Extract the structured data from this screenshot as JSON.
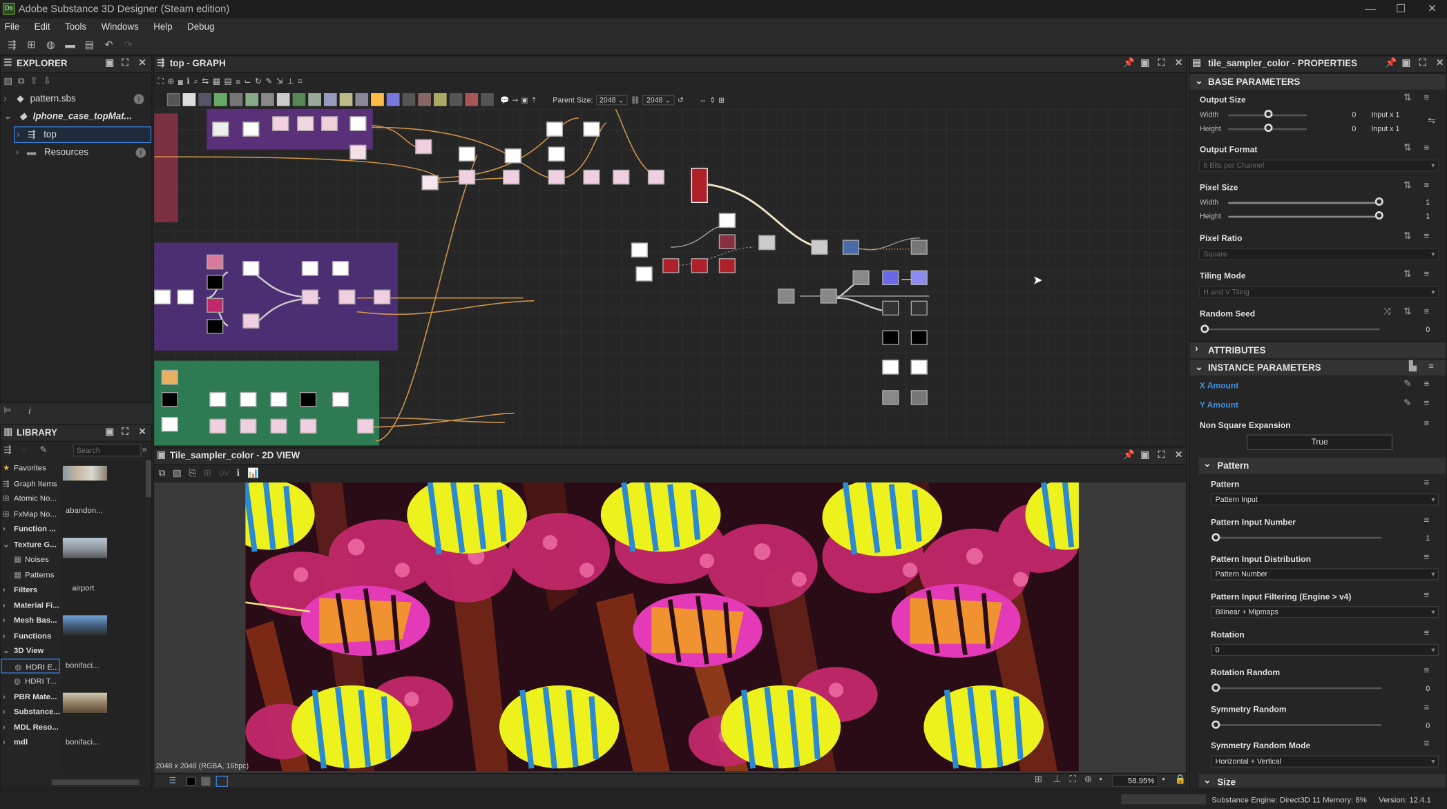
{
  "window": {
    "title": "Adobe Substance 3D Designer (Steam edition)",
    "logo": "Ds"
  },
  "menu": [
    "File",
    "Edit",
    "Tools",
    "Windows",
    "Help",
    "Debug"
  ],
  "explorer": {
    "title": "EXPLORER",
    "items": [
      {
        "label": "pattern.sbs"
      },
      {
        "label": "Iphone_case_topMat..."
      },
      {
        "label": "top"
      },
      {
        "label": "Resources"
      }
    ]
  },
  "library": {
    "title": "LIBRARY",
    "search_placeholder": "Search",
    "categories": [
      "Favorites",
      "Graph Items",
      "Atomic No...",
      "FxMap No...",
      "Function ...",
      "Texture G...",
      "Noises",
      "Patterns",
      "Filters",
      "Material Fi...",
      "Mesh Bas...",
      "Functions",
      "3D View",
      "HDRI E...",
      "HDRI T...",
      "PBR Mate...",
      "Substance...",
      "MDL Reso...",
      "mdl"
    ],
    "thumbs": [
      "abandon...",
      "airport",
      "bonifaci...",
      "bonifaci..."
    ]
  },
  "graph": {
    "title": "top - GRAPH",
    "parent_size_label": "Parent Size:",
    "parent_size": "2048",
    "size2": "2048"
  },
  "view2d": {
    "title": "Tile_sampler_color - 2D VIEW",
    "uv": "UV",
    "info": "2048 x 2048 (RGBA, 16bpc)",
    "zoom": "58.95%"
  },
  "properties": {
    "title": "tile_sampler_color - PROPERTIES",
    "base": "BASE PARAMETERS",
    "output_size": "Output Size",
    "width": "Width",
    "height": "Height",
    "w_val": "0",
    "h_val": "0",
    "w_input": "Input x 1",
    "h_input": "Input x 1",
    "output_format": "Output Format",
    "output_format_val": "8 Bits per Channel",
    "pixel_size": "Pixel Size",
    "ps_w": "1",
    "ps_h": "1",
    "pixel_ratio": "Pixel Ratio",
    "pixel_ratio_val": "Square",
    "tiling_mode": "Tiling Mode",
    "tiling_mode_val": "H and V Tiling",
    "random_seed": "Random Seed",
    "random_seed_val": "0",
    "attributes": "ATTRIBUTES",
    "instance": "INSTANCE PARAMETERS",
    "x_amount": "X Amount",
    "y_amount": "Y Amount",
    "non_square": "Non Square Expansion",
    "non_square_val": "True",
    "pattern_group": "Pattern",
    "pattern": "Pattern",
    "pattern_val": "Pattern Input",
    "pin": "Pattern Input Number",
    "pin_val": "1",
    "pid": "Pattern Input Distribution",
    "pid_val": "Pattern Number",
    "pif": "Pattern Input Filtering (Engine > v4)",
    "pif_val": "Bilinear + Mipmaps",
    "rotation": "Rotation",
    "rotation_val": "0",
    "rot_random": "Rotation Random",
    "rot_random_val": "0",
    "sym_random": "Symmetry Random",
    "sym_random_val": "0",
    "sym_mode": "Symmetry Random Mode",
    "sym_mode_val": "Horizontal + Vertical",
    "size_group": "Size"
  },
  "status": {
    "engine": "Substance Engine: Direct3D 11 Memory: 8%",
    "version": "Version: 12.4.1"
  }
}
